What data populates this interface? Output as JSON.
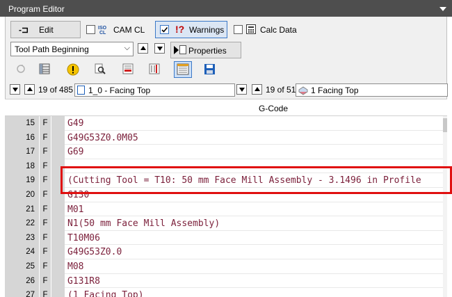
{
  "window": {
    "title": "Program Editor"
  },
  "toolbar1": {
    "edit_label": "Edit",
    "camcl_label": "CAM CL",
    "warnings_label": "Warnings",
    "calcdata_label": "Calc Data"
  },
  "toolbar2": {
    "select_value": "Tool Path Beginning",
    "properties_label": "Properties"
  },
  "nav": {
    "left_count": "19 of 485",
    "left_item": "1_0 - Facing Top",
    "right_count": "19 of 51",
    "right_item": "1 Facing Top"
  },
  "grid": {
    "column_header": "G-Code",
    "rows": [
      {
        "n": "15",
        "f": "F",
        "code": "G49"
      },
      {
        "n": "16",
        "f": "F",
        "code": "G49G53Z0.0M05"
      },
      {
        "n": "17",
        "f": "F",
        "code": "G69"
      },
      {
        "n": "18",
        "f": "F",
        "code": ""
      },
      {
        "n": "19",
        "f": "F",
        "code": "(Cutting Tool = T10: 50 mm Face Mill Assembly - 3.1496 in Profile"
      },
      {
        "n": "20",
        "f": "F",
        "code": "G130"
      },
      {
        "n": "21",
        "f": "F",
        "code": "M01"
      },
      {
        "n": "22",
        "f": "F",
        "code": "N1(50 mm Face Mill Assembly)"
      },
      {
        "n": "23",
        "f": "F",
        "code": "T10M06"
      },
      {
        "n": "24",
        "f": "F",
        "code": "G49G53Z0.0"
      },
      {
        "n": "25",
        "f": "F",
        "code": "M08"
      },
      {
        "n": "26",
        "f": "F",
        "code": "G131R8"
      },
      {
        "n": "27",
        "f": "F",
        "code": "(1 Facing Top)"
      }
    ]
  },
  "colors": {
    "highlight": "#e01010",
    "code_text": "#7b1f3a",
    "title_bg": "#4e4e4e"
  }
}
